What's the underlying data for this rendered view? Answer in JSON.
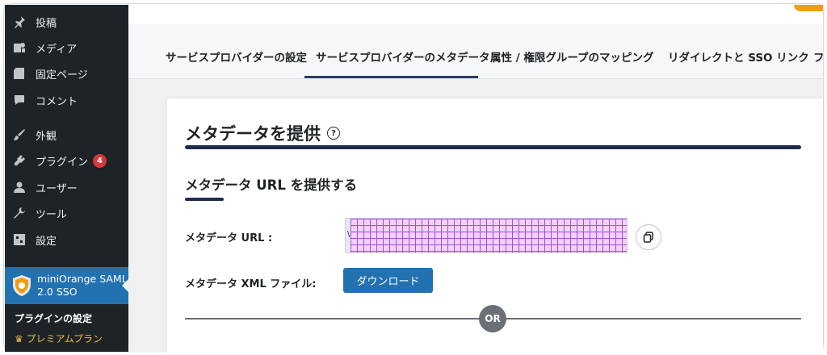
{
  "sidebar": {
    "items": [
      {
        "label": "投稿",
        "icon": "pin-icon"
      },
      {
        "label": "メディア",
        "icon": "media-icon"
      },
      {
        "label": "固定ページ",
        "icon": "page-icon"
      },
      {
        "label": "コメント",
        "icon": "comment-icon"
      },
      {
        "label": "外観",
        "icon": "appearance-icon"
      },
      {
        "label": "プラグイン",
        "icon": "plugin-icon",
        "badge": "4"
      },
      {
        "label": "ユーザー",
        "icon": "user-icon"
      },
      {
        "label": "ツール",
        "icon": "wrench-icon"
      },
      {
        "label": "設定",
        "icon": "settings-icon"
      }
    ],
    "active_plugin": {
      "line1": "miniOrange SAML",
      "line2": "2.0 SSO"
    },
    "submenu_heading": "プラグインの設定",
    "submenu_premium": "♛ プレミアムプラン"
  },
  "tabs": [
    {
      "label": "サービスプロバイダーの設定"
    },
    {
      "label": "サービスプロバイダーのメタデータ",
      "active": true
    },
    {
      "label": "属性 / 権限グループのマッピング"
    },
    {
      "label": "リダイレクトと SSO リンク"
    },
    {
      "label": "フ"
    }
  ],
  "card": {
    "title": "メタデータを提供",
    "help": "?",
    "section_title": "メタデータ URL を提供する",
    "url_label": "メタデータ URL :",
    "url_value": "\\",
    "xml_label": "メタデータ XML ファイル:",
    "download_label": "ダウンロード",
    "or_label": "OR"
  },
  "colors": {
    "sidebar_bg": "#1d2327",
    "accent": "#2271b1",
    "rule": "#1d2b4f",
    "badge": "#d63638",
    "orange": "#f39c12"
  }
}
